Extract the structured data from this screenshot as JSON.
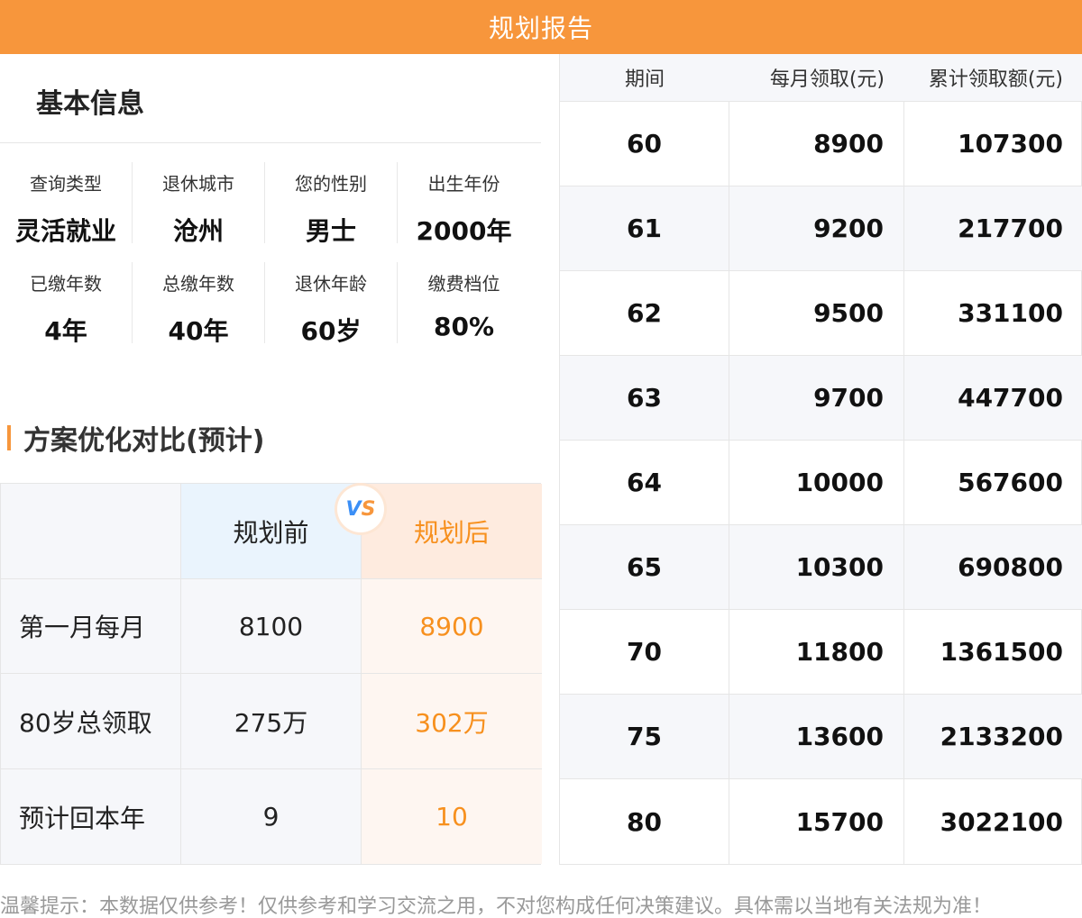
{
  "header": {
    "title": "规划报告"
  },
  "basic_info": {
    "title": "基本信息",
    "items": [
      {
        "label": "查询类型",
        "value": "灵活就业"
      },
      {
        "label": "退休城市",
        "value": "沧州"
      },
      {
        "label": "您的性别",
        "value": "男士"
      },
      {
        "label": "出生年份",
        "value": "2000年"
      },
      {
        "label": "已缴年数",
        "value": "4年"
      },
      {
        "label": "总缴年数",
        "value": "40年"
      },
      {
        "label": "退休年龄",
        "value": "60岁"
      },
      {
        "label": "缴费档位",
        "value": "80%"
      }
    ]
  },
  "compare": {
    "title": "方案优化对比(预计)",
    "before_label": "规划前",
    "after_label": "规划后",
    "vs_v": "V",
    "vs_s": "S",
    "rows": [
      {
        "label": "第一月每月",
        "before": "8100",
        "after": "8900"
      },
      {
        "label": "80岁总领取",
        "before": "275万",
        "after": "302万"
      },
      {
        "label": "预计回本年",
        "before": "9",
        "after": "10"
      }
    ]
  },
  "table": {
    "headers": [
      "期间",
      "每月领取(元)",
      "累计领取额(元)"
    ],
    "rows": [
      {
        "period": "60",
        "monthly": "8900",
        "total": "107300"
      },
      {
        "period": "61",
        "monthly": "9200",
        "total": "217700"
      },
      {
        "period": "62",
        "monthly": "9500",
        "total": "331100"
      },
      {
        "period": "63",
        "monthly": "9700",
        "total": "447700"
      },
      {
        "period": "64",
        "monthly": "10000",
        "total": "567600"
      },
      {
        "period": "65",
        "monthly": "10300",
        "total": "690800"
      },
      {
        "period": "70",
        "monthly": "11800",
        "total": "1361500"
      },
      {
        "period": "75",
        "monthly": "13600",
        "total": "2133200"
      },
      {
        "period": "80",
        "monthly": "15700",
        "total": "3022100"
      }
    ]
  },
  "footer": {
    "text": "温馨提示：本数据仅供参考！仅供参考和学习交流之用，不对您构成任何决策建议。具体需以当地有关法规为准！"
  },
  "colors": {
    "accent": "#f7963c",
    "after_text": "#f7901e",
    "vs_blue": "#3b8ff6"
  }
}
